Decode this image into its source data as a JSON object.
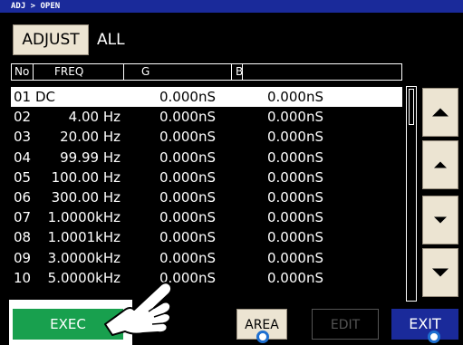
{
  "header": {
    "breadcrumb": "ADJ > OPEN"
  },
  "mode": {
    "button_label": "ADJUST",
    "value": "ALL"
  },
  "table": {
    "columns": [
      "No",
      "FREQ",
      "G",
      "B"
    ],
    "rows": [
      {
        "no": "01",
        "freq": "DC",
        "g": "0.000nS",
        "b": "0.000nS"
      },
      {
        "no": "02",
        "freq": "4.00 Hz",
        "g": "0.000nS",
        "b": "0.000nS"
      },
      {
        "no": "03",
        "freq": "20.00 Hz",
        "g": "0.000nS",
        "b": "0.000nS"
      },
      {
        "no": "04",
        "freq": "99.99 Hz",
        "g": "0.000nS",
        "b": "0.000nS"
      },
      {
        "no": "05",
        "freq": "100.00 Hz",
        "g": "0.000nS",
        "b": "0.000nS"
      },
      {
        "no": "06",
        "freq": "300.00 Hz",
        "g": "0.000nS",
        "b": "0.000nS"
      },
      {
        "no": "07",
        "freq": "1.0000kHz",
        "g": "0.000nS",
        "b": "0.000nS"
      },
      {
        "no": "08",
        "freq": "1.0001kHz",
        "g": "0.000nS",
        "b": "0.000nS"
      },
      {
        "no": "09",
        "freq": "3.0000kHz",
        "g": "0.000nS",
        "b": "0.000nS"
      },
      {
        "no": "10",
        "freq": "5.0000kHz",
        "g": "0.000nS",
        "b": "0.000nS"
      }
    ]
  },
  "buttons": {
    "exec": "EXEC",
    "area": "AREA",
    "edit": "EDIT",
    "exit": "EXIT"
  },
  "colors": {
    "title_bar": "#1a2a9a",
    "exec": "#18a04e",
    "key": "#ece4d2",
    "exit": "#1a2a9a",
    "marker": "#1e6fd0"
  }
}
